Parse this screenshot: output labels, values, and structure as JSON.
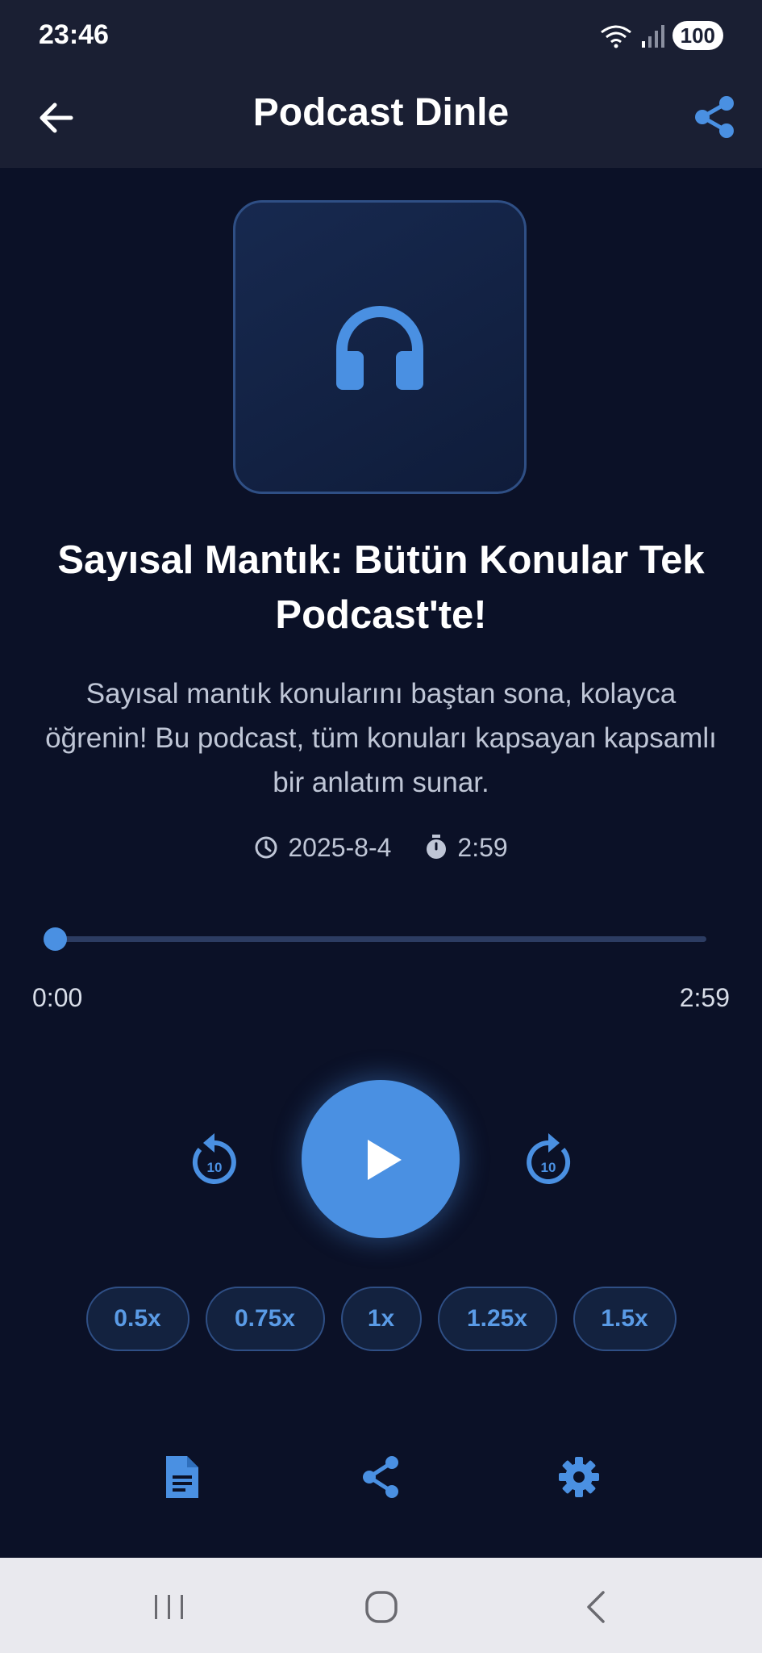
{
  "status_bar": {
    "time": "23:46",
    "battery": "100"
  },
  "app_bar": {
    "title": "Podcast Dinle"
  },
  "podcast": {
    "title": "Sayısal Mantık: Bütün Konular Tek Podcast'te!",
    "description": "Sayısal mantık konularını baştan sona, kolayca öğrenin! Bu podcast, tüm konuları kapsayan kapsamlı bir anlatım sunar.",
    "date": "2025-8-4",
    "duration": "2:59"
  },
  "player": {
    "current_time": "0:00",
    "total_time": "2:59",
    "progress": 0,
    "skip_back_label": "10",
    "skip_forward_label": "10",
    "accent_color": "#4a90e2"
  },
  "speeds": [
    {
      "label": "0.5x"
    },
    {
      "label": "0.75x"
    },
    {
      "label": "1x"
    },
    {
      "label": "1.25x"
    },
    {
      "label": "1.5x"
    }
  ],
  "icons": {
    "back": "arrow-left-icon",
    "share": "share-icon",
    "cover": "headphones-icon",
    "date": "clock-icon",
    "duration": "timer-icon",
    "transcript": "document-icon",
    "settings": "gear-icon"
  }
}
